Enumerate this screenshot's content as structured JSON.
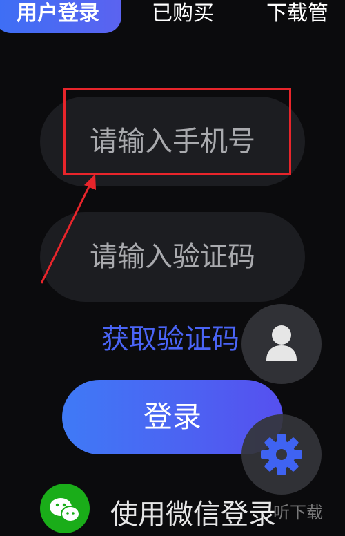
{
  "tabs": [
    {
      "label": "用户登录",
      "active": true
    },
    {
      "label": "已购买",
      "active": false
    },
    {
      "label": "下载管",
      "active": false
    }
  ],
  "form": {
    "phone_placeholder": "请输入手机号",
    "code_placeholder": "请输入验证码",
    "get_code_label": "获取验证码",
    "login_label": "登录"
  },
  "wechat": {
    "label": "使用微信登录"
  },
  "floating_buttons": [
    "person-icon",
    "gear-icon"
  ],
  "watermark": "一听下载",
  "colors": {
    "accent": "#4a64f5",
    "gradient_start": "#3f7af6",
    "gradient_end": "#5650ef",
    "annotation_red": "#e8252b",
    "wechat_green": "#1aad19"
  }
}
